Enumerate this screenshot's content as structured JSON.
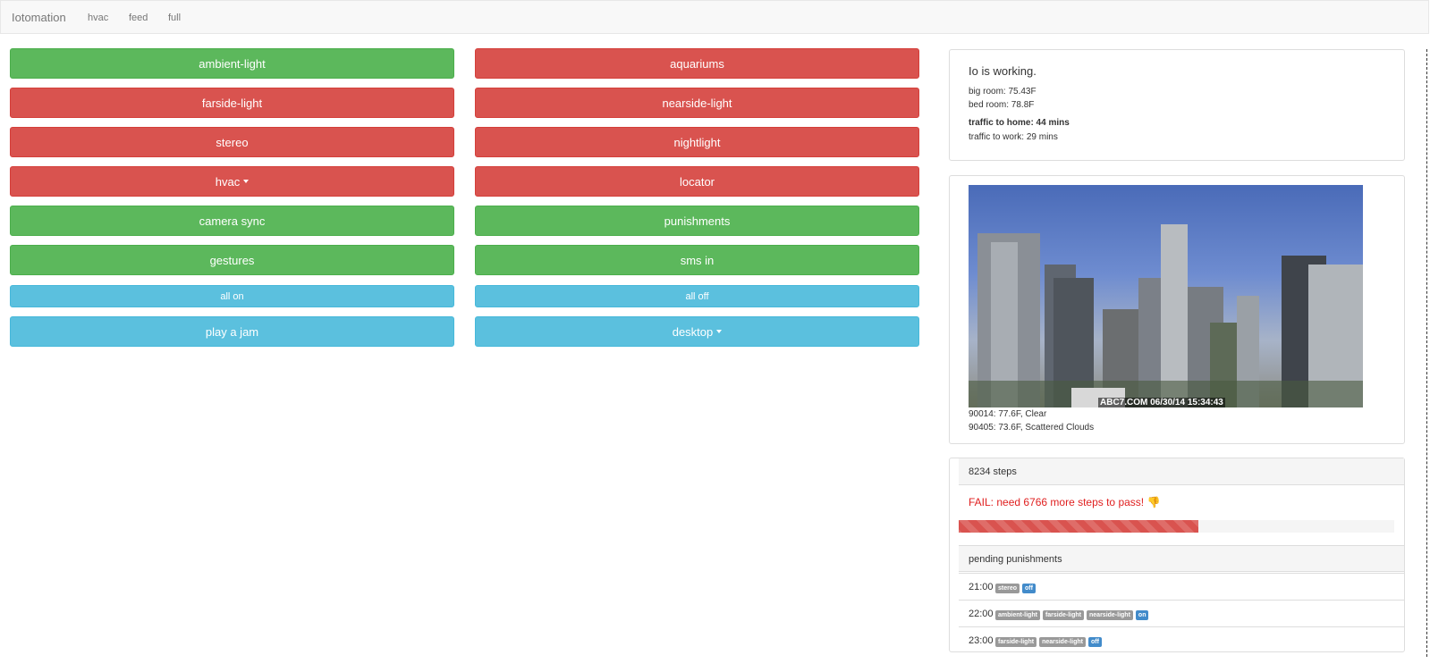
{
  "nav": {
    "brand": "Iotomation",
    "links": [
      "hvac",
      "feed",
      "full"
    ]
  },
  "buttons": {
    "left": [
      {
        "label": "ambient-light",
        "color": "#5cb85c"
      },
      {
        "label": "farside-light",
        "color": "#d9534f"
      },
      {
        "label": "stereo",
        "color": "#d9534f"
      },
      {
        "label": "hvac",
        "color": "#d9534f",
        "dropdown": true
      },
      {
        "label": "camera sync",
        "color": "#5cb85c"
      },
      {
        "label": "gestures",
        "color": "#5cb85c"
      },
      {
        "label": "all on",
        "color": "#5bc0de"
      },
      {
        "label": "play a jam",
        "color": "#5bc0de"
      }
    ],
    "right": [
      {
        "label": "aquariums",
        "color": "#d9534f"
      },
      {
        "label": "nearside-light",
        "color": "#d9534f"
      },
      {
        "label": "nightlight",
        "color": "#d9534f"
      },
      {
        "label": "locator",
        "color": "#d9534f"
      },
      {
        "label": "punishments",
        "color": "#5cb85c"
      },
      {
        "label": "sms in",
        "color": "#5cb85c"
      },
      {
        "label": "all off",
        "color": "#5bc0de"
      },
      {
        "label": "desktop",
        "color": "#5bc0de",
        "dropdown": true
      }
    ]
  },
  "status": {
    "title": "Io is working.",
    "big_room": "big room: 75.43F",
    "bed_room": "bed room: 78.8F",
    "traffic_home": "traffic to home: 44 mins",
    "traffic_work": "traffic to work: 29 mins"
  },
  "camera": {
    "stamp": "ABC7.COM 06/30/14 15:34:43",
    "weather": [
      "90014: 77.6F, Clear",
      "90405: 73.6F, Scattered Clouds"
    ]
  },
  "steps": {
    "count_label": "8234 steps",
    "fail_text": "FAIL: need 6766 more steps to pass!",
    "fail_icon": "thumbs-down-icon",
    "progress_fraction": 0.55,
    "progress_color": "#d9534f"
  },
  "punishments": {
    "heading": "pending punishments",
    "rows": [
      {
        "time": "21:00",
        "tags": [
          "stereo"
        ],
        "state": "off"
      },
      {
        "time": "22:00",
        "tags": [
          "ambient-light",
          "farside-light",
          "nearside-light"
        ],
        "state": "on"
      },
      {
        "time": "23:00",
        "tags": [
          "farside-light",
          "nearside-light"
        ],
        "state": "off"
      }
    ]
  }
}
